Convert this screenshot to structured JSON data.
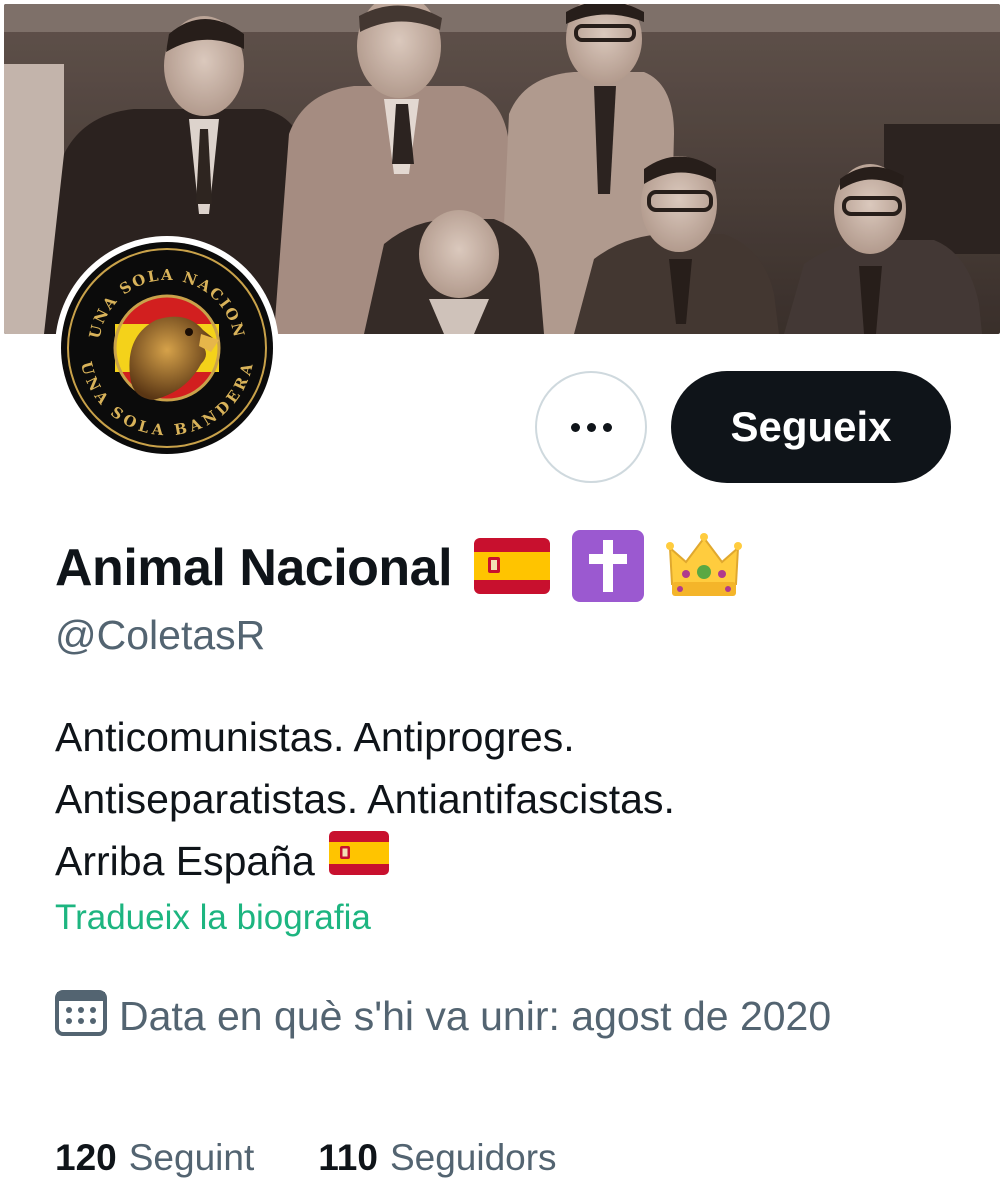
{
  "profile": {
    "display_name": "Animal Nacional",
    "name_emojis": [
      "spain-flag",
      "latin-cross",
      "crown"
    ],
    "handle": "@ColetasR",
    "avatar_text_top": "UNA SOLA NACION",
    "avatar_text_bottom": "UNA SOLA BANDERA"
  },
  "actions": {
    "more_label": "...",
    "follow_label": "Segueix"
  },
  "bio": {
    "lines": [
      "Anticomunistas. Antiprogres.",
      "Antiseparatistas. Antiantifascistas.",
      "Arriba España"
    ],
    "translate_label": "Tradueix la biografia"
  },
  "joined": {
    "icon": "calendar-icon",
    "text": "Data en què s'hi va unir: agost de 2020"
  },
  "stats": {
    "following_count": "120",
    "following_label": "Seguint",
    "followers_count": "110",
    "followers_label": "Seguidors"
  },
  "colors": {
    "primary_text": "#0f1419",
    "secondary_text": "#536471",
    "link": "#1db580",
    "follow_button_bg": "#0f1419",
    "border": "#cfd9de"
  }
}
